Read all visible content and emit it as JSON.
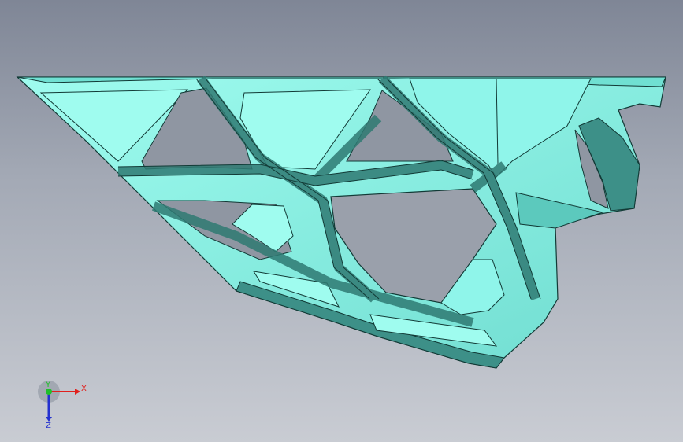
{
  "viewport": {
    "background_top": "#7f8696",
    "background_bottom": "#c9ccd3"
  },
  "model": {
    "face_color": "#8ff5ea",
    "face_shade_color": "#5cc9bd",
    "face_dark_color": "#2f7a73",
    "edge_color": "#123a36",
    "hole_color": "#9aa0ab"
  },
  "triad": {
    "x_label": "X",
    "y_label": "Y",
    "z_label": "Z",
    "x_color": "#e0201d",
    "y_color": "#1fbf2a",
    "z_color": "#2330d0"
  }
}
